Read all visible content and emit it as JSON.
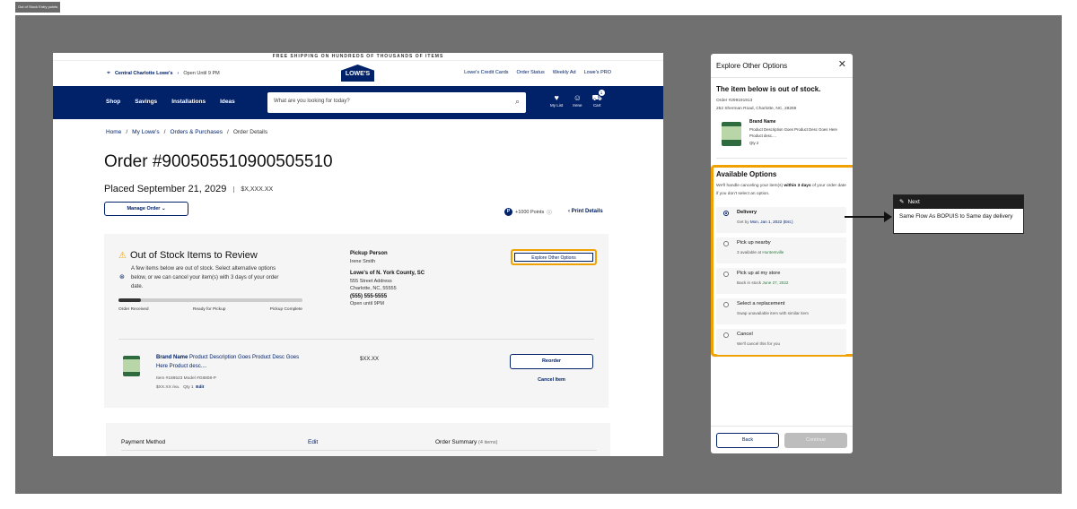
{
  "frame_label": "Out of Stock Entry points",
  "site": {
    "promo": "FREE SHIPPING ON HUNDREDS OF THOUSANDS OF ITEMS",
    "store_name": "Central Charlotte Lowe's",
    "store_hours": "Open Until 9 PM",
    "logo": "LOWE'S",
    "util_links": [
      "Lowe's Credit Cards",
      "Order Status",
      "Weekly Ad",
      "Lowe's PRO"
    ],
    "nav": [
      "Shop",
      "Savings",
      "Installations",
      "Ideas"
    ],
    "search_placeholder": "What are you looking for today?",
    "icons": [
      {
        "name": "heart-icon",
        "glyph": "♥",
        "label": "My List"
      },
      {
        "name": "user-icon",
        "glyph": "☺",
        "label": "Irene"
      },
      {
        "name": "cart-icon",
        "glyph": "🛒",
        "label": "Cart"
      }
    ],
    "cart_count": "1"
  },
  "breadcrumb": {
    "home": "Home",
    "sep": "/",
    "my_lowes": "My Lowe's",
    "orders": "Orders & Purchases",
    "current": "Order Details"
  },
  "order": {
    "title": "Order #900505510900505510",
    "placed": "Placed September 21, 2029",
    "amount": "$X,XXX.XX",
    "manage": "Manage Order",
    "points": "+1000 Points",
    "print": "Print Details"
  },
  "oos": {
    "title": "Out of Stock Items to Review",
    "desc": "A few items below are out of stock. Select alternative options below, or we can cancel your item(s) with 3 days of your order date.",
    "progress": 0.12,
    "progress_labels": [
      "Order Received",
      "Ready for Pickup",
      "Pickup Complete"
    ],
    "pickup_head": "Pickup Person",
    "pickup_name": "Irene Smith",
    "store": "Lowe's of N. York County, SC",
    "addr1": "555 Street Address",
    "addr2": "Charlotte, NC, 55555",
    "phone": "(555) 555-5555",
    "hours": "Open until 9PM",
    "explore": "Explore Other Options"
  },
  "item": {
    "brand": "Brand Name",
    "desc": "Product Description Goes Product Desc Goes Here Product desc....",
    "meta1": "Item #188523 Model #G8808-P",
    "price_each": "$XX.XX /ea.",
    "qty": "Qty 1",
    "edit": "Edit",
    "price": "$XX.XX",
    "reorder": "Reorder",
    "cancel": "Cancel Item"
  },
  "payment": {
    "label": "Payment Method",
    "edit": "Edit",
    "summary": "Order Summary",
    "count": "(4 items)"
  },
  "panel": {
    "title": "Explore Other Options",
    "heading": "The item below is out of stock.",
    "order_no": "Order #299191913",
    "address": "252 Sherman Road, Charlotte, NC, 28269",
    "brand": "Brand Name",
    "product": "Product Description Goes Product Desc Goes Here Product desc....",
    "qty": "Qty 2",
    "available_title": "Available Options",
    "available_desc_a": "We'll handle canceling your item(s) ",
    "available_desc_b": "within 3 days",
    "available_desc_c": " of your order date if you don't select an option.",
    "options": [
      {
        "label": "Delivery",
        "sub_a": "Get by ",
        "sub_b": "Mon, Jan 1, 2022 (Est.)",
        "selected": true
      },
      {
        "label": "Pick up nearby",
        "sub_a": "3 available at ",
        "sub_b": "Huntersville",
        "selected": false
      },
      {
        "label": "Pick up at my store",
        "sub_a": "Back in stock ",
        "sub_b": "June 27, 2022",
        "selected": false
      },
      {
        "label": "Select a replacement",
        "sub_a": "Swap unavailable item with similar item",
        "sub_b": "",
        "selected": false
      },
      {
        "label": "Cancel",
        "sub_a": "We'll cancel this for you",
        "sub_b": "",
        "selected": false
      }
    ],
    "back": "Back",
    "continue": "Continue"
  },
  "annotation": {
    "head": "Next",
    "body": "Same Flow As BOPUIS to Same day delivery"
  },
  "colors": {
    "brand": "#012169",
    "accent": "#f1a203",
    "board": "#707070"
  }
}
